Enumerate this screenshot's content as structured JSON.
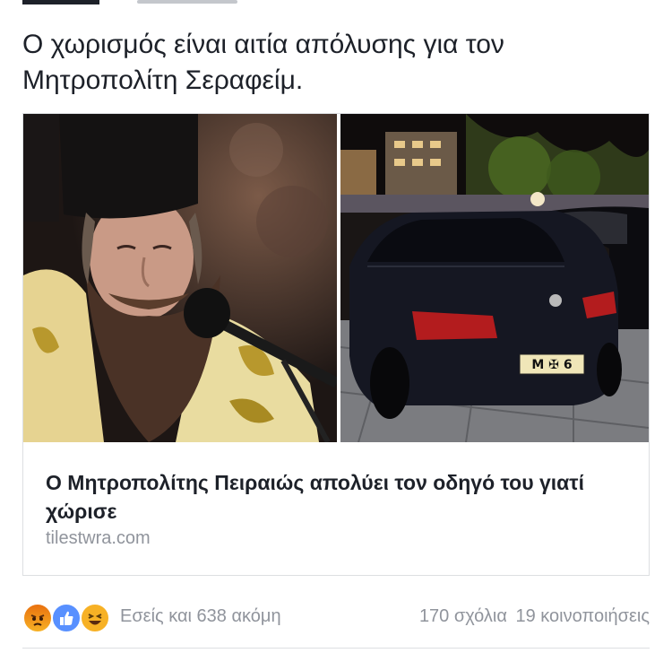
{
  "post": {
    "text": "Ο χωρισμός είναι αιτία απόλυσης για τον Μητροπολίτη Σεραφείμ."
  },
  "link_card": {
    "title": "Ο Μητροπολίτης Πειραιώς απολύει τον οδηγό του γιατί χώρισε",
    "domain": "tilestwra.com",
    "images": [
      {
        "icon": "priest-photo"
      },
      {
        "icon": "car-photo",
        "plate_text": "M ✠ 6"
      }
    ]
  },
  "footer": {
    "reactions": [
      "angry-icon",
      "like-icon",
      "haha-icon"
    ],
    "likers": "Εσείς και 638 ακόμη",
    "comments": "170 σχόλια",
    "shares": "19 κοινοποιήσεις"
  },
  "colors": {
    "text": "#1d2129",
    "muted": "#90949c",
    "border": "#dddfe2",
    "like_blue": "#5890ff",
    "reaction_yellow": "#f7b125"
  }
}
